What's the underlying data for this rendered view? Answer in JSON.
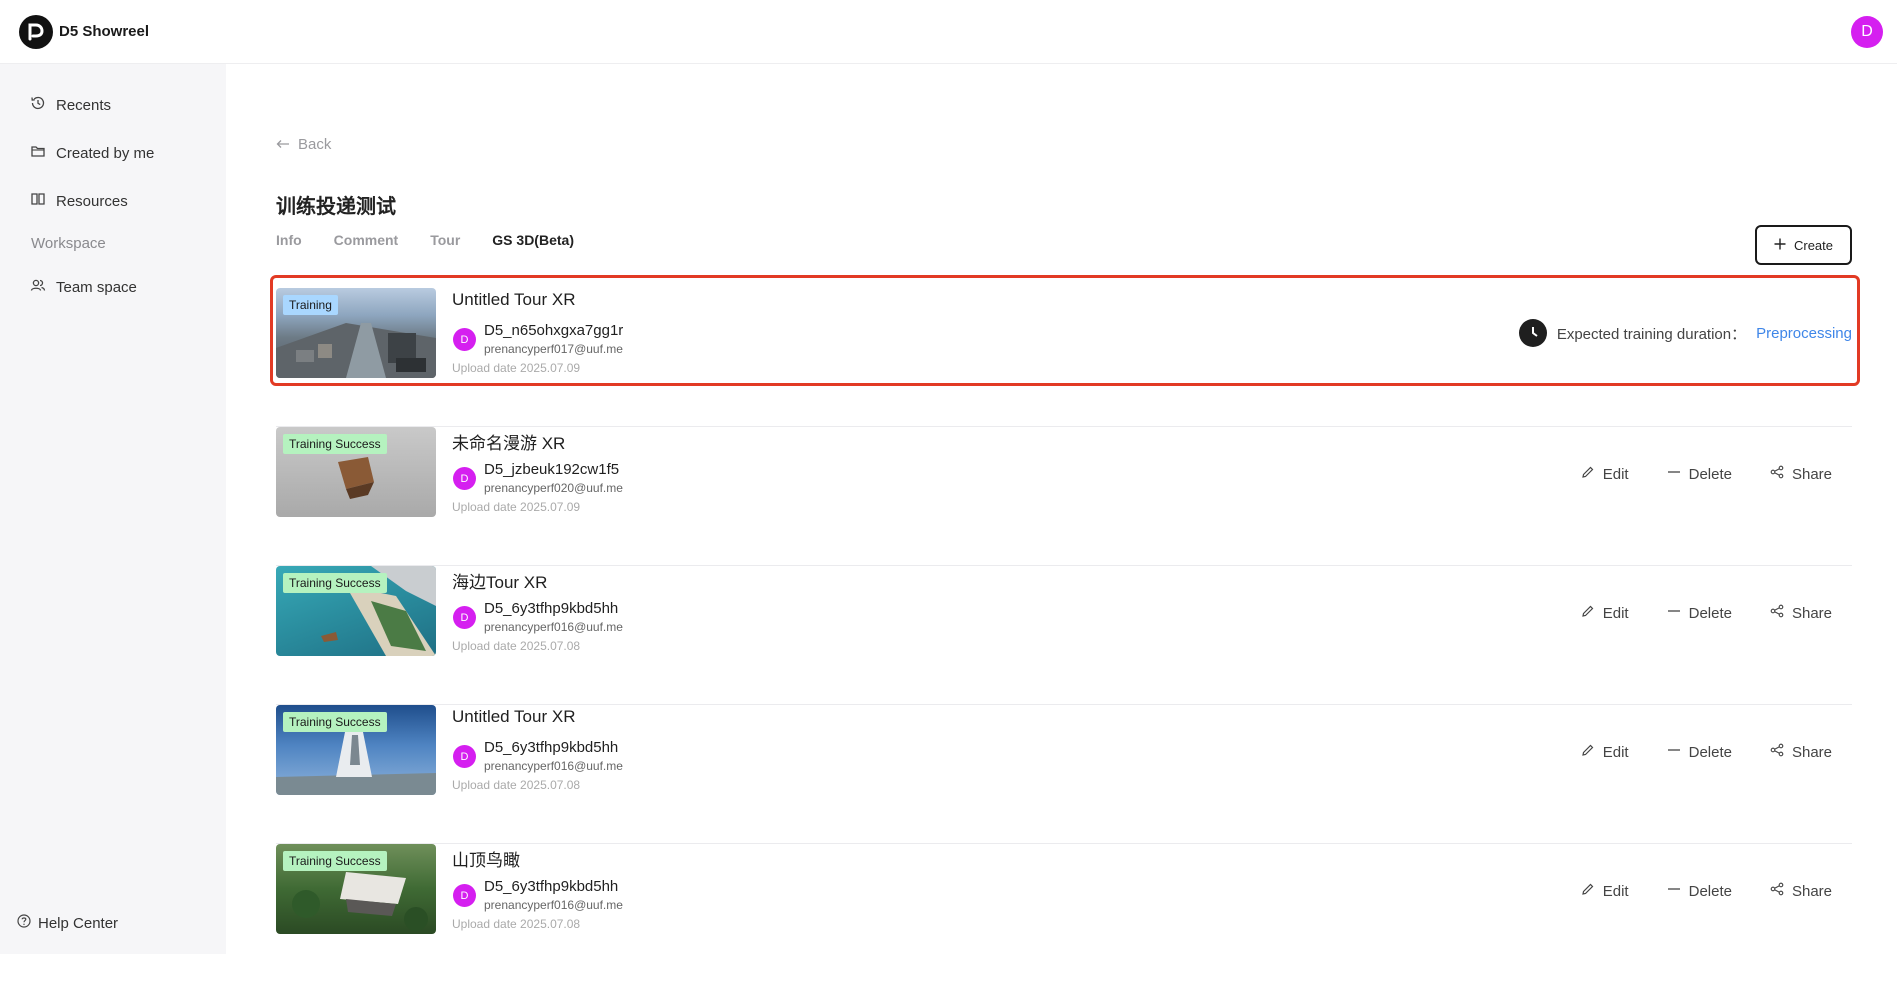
{
  "app": {
    "title": "D5 Showreel",
    "user_initial": "D"
  },
  "sidebar": {
    "items": [
      {
        "label": "Recents",
        "icon": "history-icon"
      },
      {
        "label": "Created by me",
        "icon": "folder-icon"
      },
      {
        "label": "Resources",
        "icon": "book-icon"
      }
    ],
    "section_label": "Workspace",
    "workspace_items": [
      {
        "label": "Team space",
        "icon": "team-icon"
      }
    ],
    "help_label": "Help Center"
  },
  "page": {
    "back_label": "Back",
    "title": "训练投递测试",
    "tabs": [
      {
        "label": "Info",
        "active": false
      },
      {
        "label": "Comment",
        "active": false
      },
      {
        "label": "Tour",
        "active": false
      },
      {
        "label": "GS 3D(Beta)",
        "active": true
      }
    ],
    "create_label": "Create"
  },
  "actions": {
    "edit": "Edit",
    "delete": "Delete",
    "share": "Share"
  },
  "status_text": {
    "expected": "Expected training duration：",
    "link": "Preprocessing"
  },
  "rows": [
    {
      "badge": "Training",
      "badge_type": "training",
      "title": "Untitled Tour XR",
      "avatar": "D",
      "user": "D5_n65ohxgxa7gg1r",
      "email": "prenancyperf017@uuf.me",
      "date": "Upload date 2025.07.09"
    },
    {
      "badge": "Training Success",
      "badge_type": "success",
      "title": "未命名漫游 XR",
      "avatar": "D",
      "user": "D5_jzbeuk192cw1f5",
      "email": "prenancyperf020@uuf.me",
      "date": "Upload date 2025.07.09"
    },
    {
      "badge": "Training Success",
      "badge_type": "success",
      "title": "海边Tour XR",
      "avatar": "D",
      "user": "D5_6y3tfhp9kbd5hh",
      "email": "prenancyperf016@uuf.me",
      "date": "Upload date 2025.07.08"
    },
    {
      "badge": "Training Success",
      "badge_type": "success",
      "title": "Untitled Tour XR",
      "avatar": "D",
      "user": "D5_6y3tfhp9kbd5hh",
      "email": "prenancyperf016@uuf.me",
      "date": "Upload date 2025.07.08"
    },
    {
      "badge": "Training Success",
      "badge_type": "success",
      "title": "山顶鸟瞰",
      "avatar": "D",
      "user": "D5_6y3tfhp9kbd5hh",
      "email": "prenancyperf016@uuf.me",
      "date": "Upload date 2025.07.08"
    }
  ]
}
